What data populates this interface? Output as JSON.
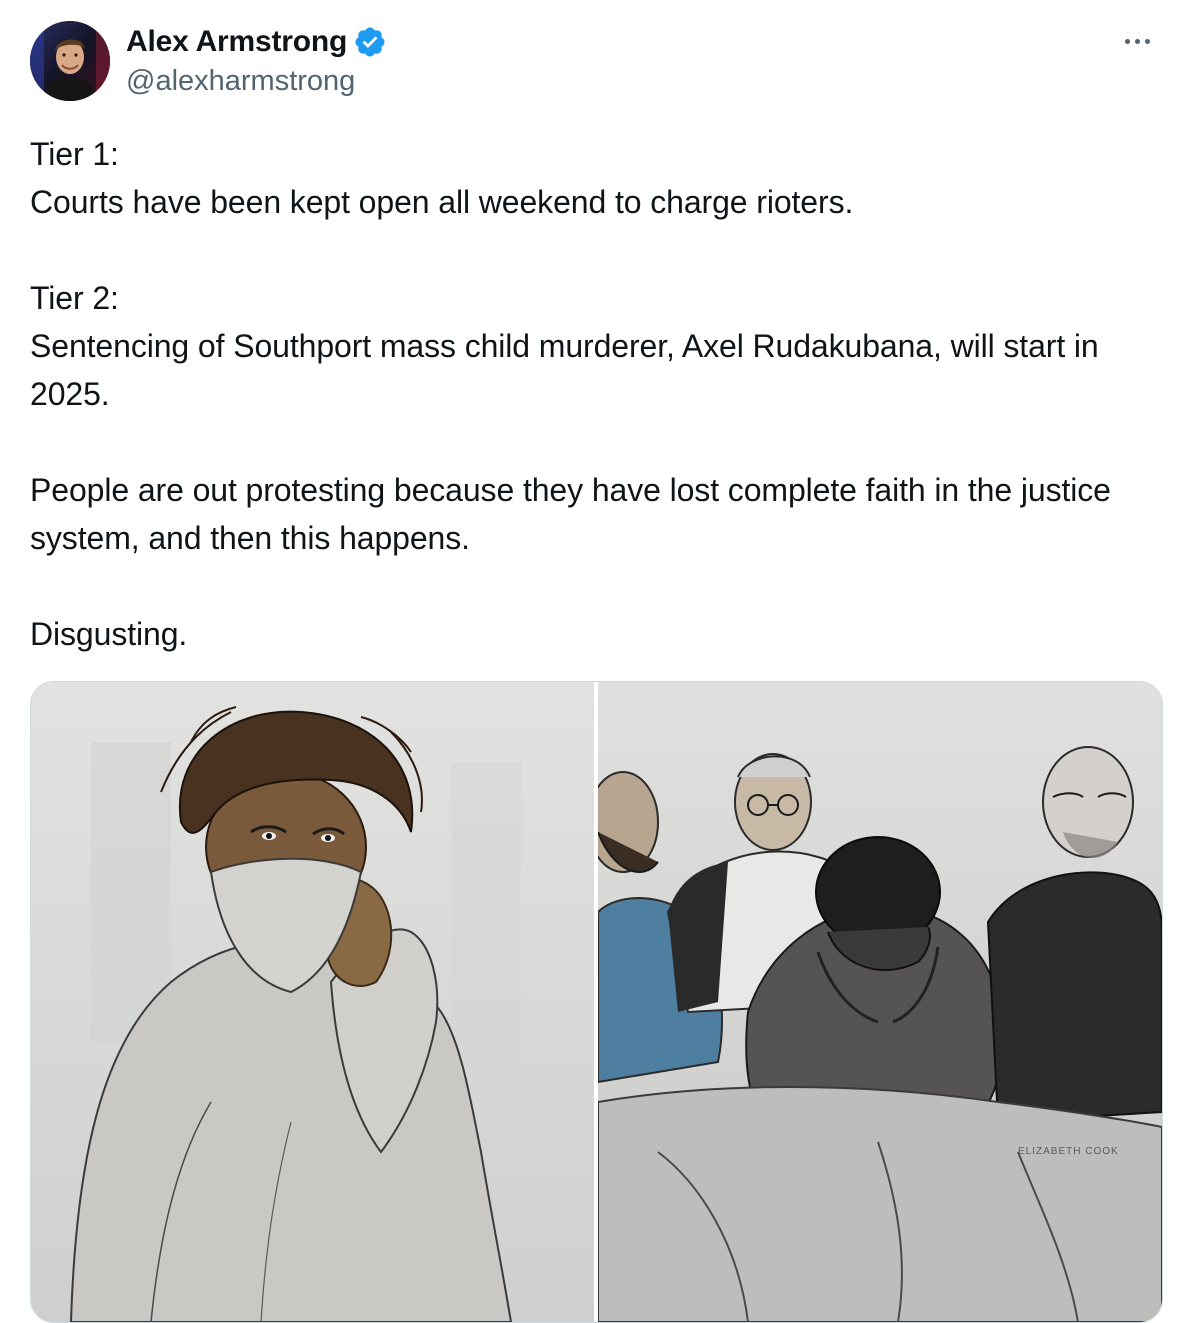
{
  "author": {
    "display_name": "Alex Armstrong",
    "handle": "@alexharmstrong",
    "verified": true,
    "verified_color": "#1d9bf0",
    "avatar_icon": "profile-photo"
  },
  "menu": {
    "more_icon": "ellipsis-icon"
  },
  "tweet": {
    "lines": {
      "tier1_heading": "Tier 1:",
      "tier1_text": "Courts have been kept open all weekend to charge rioters.",
      "tier2_heading": "Tier 2:",
      "tier2_text": "Sentencing of Southport mass child murderer, Axel Rudakubana, will start in 2025.",
      "paragraph3": "People are out protesting because they have lost complete faith in the justice system, and then this happens.",
      "closing": "Disgusting."
    }
  },
  "media": {
    "images": [
      {
        "kind": "court-sketch",
        "subject": "figure covering face with sleeve"
      },
      {
        "kind": "court-sketch",
        "subject": "figure with head in hands between guards"
      }
    ],
    "signature_text": "ELIZABETH COOK"
  },
  "colors": {
    "text_primary": "#0f1419",
    "text_secondary": "#536471",
    "border": "#cfd9de"
  }
}
